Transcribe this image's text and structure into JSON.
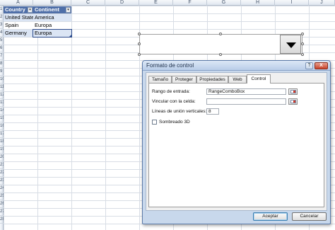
{
  "sheet": {
    "columns": [
      "A",
      "B",
      "C",
      "D",
      "E",
      "F",
      "G",
      "H",
      "I",
      "J"
    ],
    "rows": [
      "1",
      "2",
      "3",
      "4",
      "5",
      "6",
      "7",
      "8",
      "9",
      "10",
      "11",
      "12",
      "13",
      "14",
      "15",
      "16",
      "17",
      "18",
      "19",
      "20",
      "21",
      "22",
      "23",
      "24",
      "25",
      "26",
      "27",
      "28"
    ],
    "table": {
      "headers": [
        "Country",
        "Continent"
      ],
      "rows": [
        [
          "United States",
          "America"
        ],
        [
          "Spain",
          "Europa"
        ],
        [
          "Germany",
          "Europa"
        ]
      ]
    },
    "filter_arrow": "▾"
  },
  "combo_control": {
    "icon": "dropdown-triangle-icon"
  },
  "dialog": {
    "title": "Formato de control",
    "help_label": "?",
    "close_label": "X",
    "tabs": [
      {
        "label": "Tamaño",
        "active": false
      },
      {
        "label": "Proteger",
        "active": false
      },
      {
        "label": "Propiedades",
        "active": false
      },
      {
        "label": "Web",
        "active": false
      },
      {
        "label": "Control",
        "active": true
      }
    ],
    "fields": {
      "input_range_label": "Rango de entrada:",
      "input_range_value": "RangeComboBox",
      "cell_link_label": "Vincular con la celda:",
      "cell_link_value": "",
      "dropdown_lines_label": "Líneas de unión verticales:",
      "dropdown_lines_value": "8",
      "shading_label": "Sombreado 3D",
      "shading_checked": false
    },
    "buttons": {
      "ok": "Aceptar",
      "cancel": "Cancelar"
    }
  }
}
